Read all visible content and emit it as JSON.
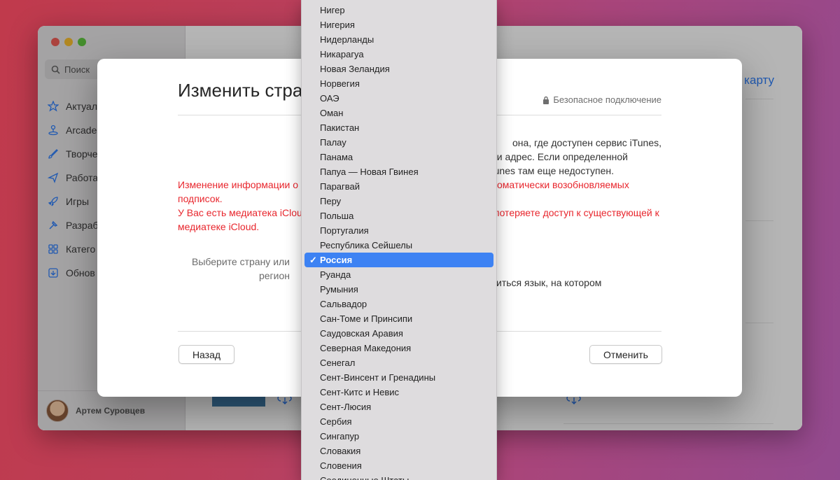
{
  "sidebar": {
    "search_label": "Поиск",
    "items": [
      {
        "label": "Актуал",
        "icon": "star-icon"
      },
      {
        "label": "Arcade",
        "icon": "joystick-icon"
      },
      {
        "label": "Творче",
        "icon": "brush-icon"
      },
      {
        "label": "Работа",
        "icon": "paperplane-icon"
      },
      {
        "label": "Игры",
        "icon": "rocket-icon"
      },
      {
        "label": "Разраб",
        "icon": "hammer-icon"
      },
      {
        "label": "Катего",
        "icon": "grid-icon"
      },
      {
        "label": "Обнов",
        "icon": "download-icon"
      }
    ],
    "user_name": "Артем Суровцев"
  },
  "main": {
    "link_text": "карту"
  },
  "dialog": {
    "title": "Изменить стра",
    "secure_label": "Безопасное подключение",
    "info_lines": [
      "она, где доступен сервис iTunes,",
      "и адрес. Если определенной",
      "unes там еще недоступен."
    ],
    "warning_line1": "Изменение информации о",
    "warning_line1_end": "оматически возобновляемых",
    "warning_line2": "подписок.",
    "warning_line3": "У Вас есть медиатека iCloud",
    "warning_line3_end": "потеряете доступ к существующей к",
    "warning_line4": "медиатеке iCloud.",
    "choose_label_1": "Выберите страну или",
    "choose_label_2": "регион",
    "lang_note": "иться язык, на котором",
    "back_button": "Назад",
    "cancel_button": "Отменить"
  },
  "country_menu": {
    "selected": "Россия",
    "items": [
      "Нигер",
      "Нигерия",
      "Нидерланды",
      "Никарагуа",
      "Новая Зеландия",
      "Норвегия",
      "ОАЭ",
      "Оман",
      "Пакистан",
      "Палау",
      "Панама",
      "Папуа — Новая Гвинея",
      "Парагвай",
      "Перу",
      "Польша",
      "Португалия",
      "Республика Сейшелы",
      "Россия",
      "Руанда",
      "Румыния",
      "Сальвадор",
      "Сан-Томе и Принсипи",
      "Саудовская Аравия",
      "Северная Македония",
      "Сенегал",
      "Сент-Винсент и Гренадины",
      "Сент-Китс и Невис",
      "Сент-Люсия",
      "Сербия",
      "Сингапур",
      "Словакия",
      "Словения",
      "Соединенные Штаты"
    ]
  }
}
